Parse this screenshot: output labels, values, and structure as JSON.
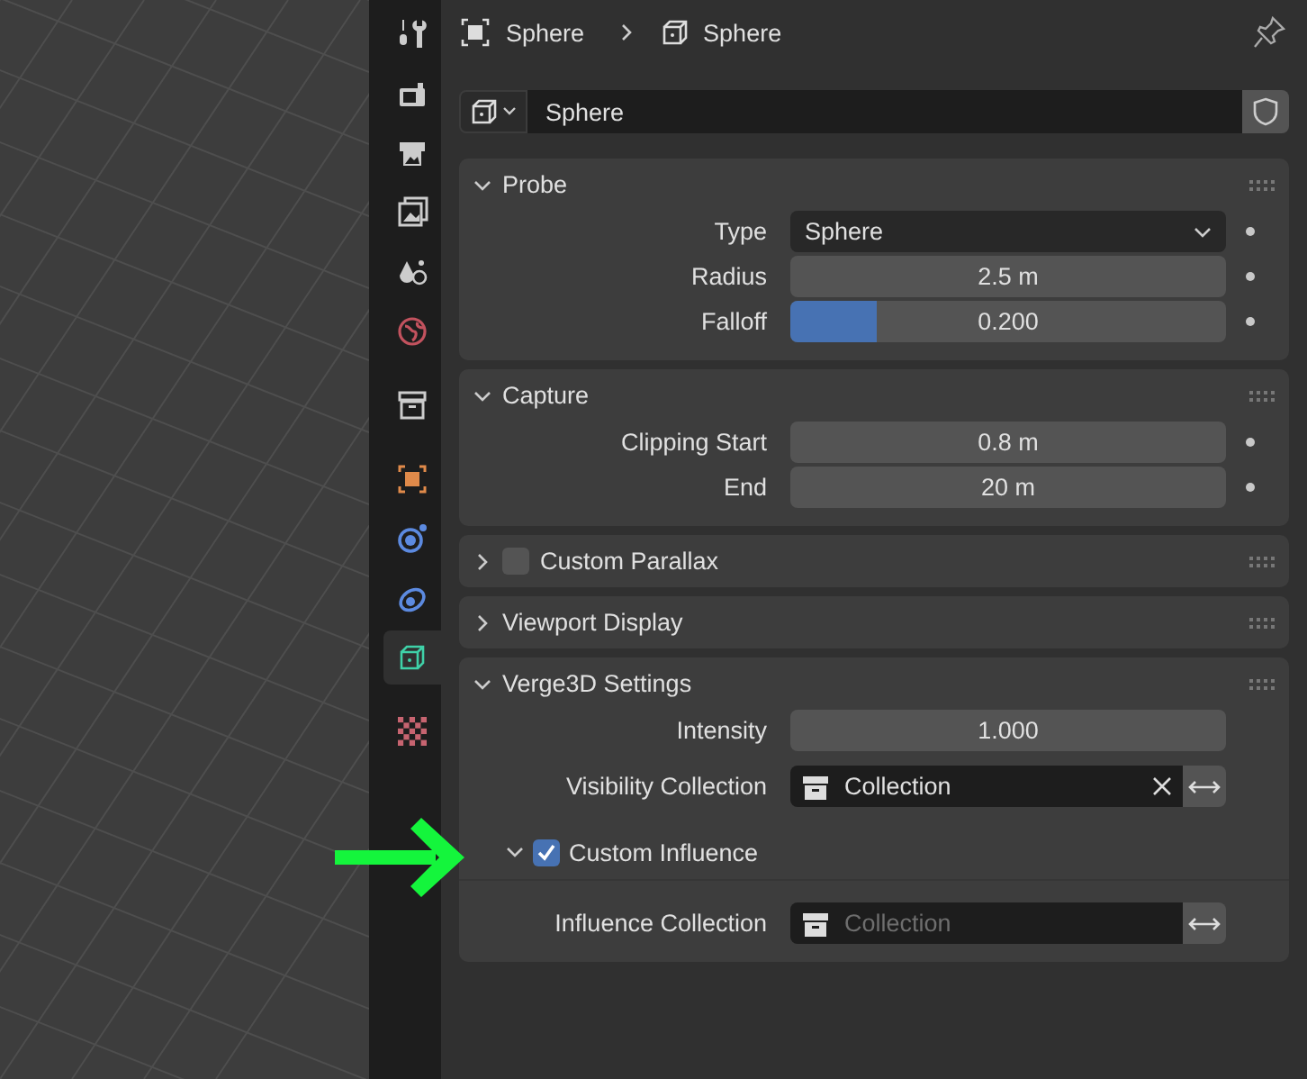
{
  "tabs": [
    {
      "kind": "tool",
      "selected": false
    },
    {
      "kind": "render",
      "selected": false
    },
    {
      "kind": "output",
      "selected": false
    },
    {
      "kind": "view_layer",
      "selected": false
    },
    {
      "kind": "scene",
      "selected": false
    },
    {
      "kind": "world",
      "selected": false
    },
    {
      "kind": "collection",
      "selected": false
    },
    {
      "kind": "object",
      "selected": false
    },
    {
      "kind": "physics",
      "selected": false
    },
    {
      "kind": "constraints",
      "selected": false
    },
    {
      "kind": "data",
      "selected": true
    },
    {
      "kind": "texture",
      "selected": false
    }
  ],
  "breadcrumb": [
    "Sphere",
    "Sphere"
  ],
  "datablock": {
    "name": "Sphere"
  },
  "panels": [
    {
      "title": "Probe",
      "expanded": true,
      "rows": [
        {
          "kind": "dropdown",
          "label": "Type",
          "value": "Sphere"
        },
        {
          "kind": "number",
          "label": "Radius",
          "value": "2.5 m"
        },
        {
          "kind": "slider",
          "label": "Falloff",
          "value": "0.200",
          "level": 0.2
        }
      ]
    },
    {
      "title": "Capture",
      "expanded": true,
      "rows": [
        {
          "kind": "number",
          "label": "Clipping Start",
          "value": "0.8 m"
        },
        {
          "kind": "number",
          "label": "End",
          "value": "20 m"
        }
      ]
    },
    {
      "title": "Custom Parallax",
      "expanded": false,
      "checkbox": {
        "checked": false
      }
    },
    {
      "title": "Viewport Display",
      "expanded": false
    },
    {
      "title": "Verge3D Settings",
      "expanded": true,
      "rows": [
        {
          "kind": "plain_number",
          "label": "Intensity",
          "value": "1.000"
        },
        {
          "kind": "collection",
          "label": "Visibility Collection",
          "value": "Collection"
        },
        {
          "kind": "subpanel",
          "label": "Custom Influence",
          "expanded": true,
          "checked": true
        },
        {
          "kind": "collection",
          "label": "Influence Collection",
          "placeholder": "Collection"
        }
      ]
    }
  ]
}
